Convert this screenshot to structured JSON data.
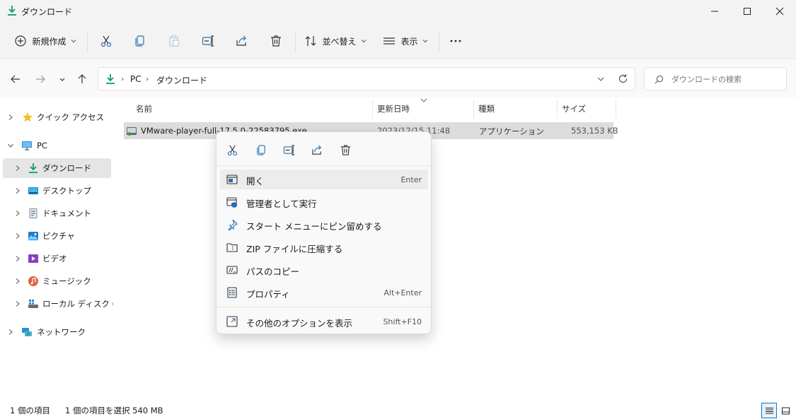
{
  "window": {
    "title": "ダウンロード",
    "accent": "#0f9a74"
  },
  "toolbar": {
    "new_label": "新規作成",
    "sort_label": "並べ替え",
    "view_label": "表示",
    "more_label": "..."
  },
  "address": {
    "crumbs": [
      "PC",
      "ダウンロード"
    ],
    "search_placeholder": "ダウンロードの検索"
  },
  "sidebar": {
    "items": [
      {
        "label": "クイック アクセス",
        "icon": "star-icon"
      },
      {
        "label": "PC",
        "icon": "pc-icon"
      },
      {
        "label": "ダウンロード",
        "icon": "download-icon"
      },
      {
        "label": "デスクトップ",
        "icon": "desktop-icon"
      },
      {
        "label": "ドキュメント",
        "icon": "document-icon"
      },
      {
        "label": "ピクチャ",
        "icon": "picture-icon"
      },
      {
        "label": "ビデオ",
        "icon": "video-icon"
      },
      {
        "label": "ミュージック",
        "icon": "music-icon"
      },
      {
        "label": "ローカル ディスク (C:)",
        "icon": "disk-icon"
      },
      {
        "label": "ネットワーク",
        "icon": "network-icon"
      }
    ]
  },
  "columns": {
    "name": "名前",
    "date": "更新日時",
    "type": "種類",
    "size": "サイズ"
  },
  "files": [
    {
      "name": "VMware-player-full-17.5.0-22583795.exe",
      "date": "2023/12/15 11:48",
      "type": "アプリケーション",
      "size": "553,153 KB"
    }
  ],
  "context_menu": {
    "items": [
      {
        "label": "開く",
        "shortcut": "Enter",
        "icon": "open-icon"
      },
      {
        "label": "管理者として実行",
        "shortcut": "",
        "icon": "admin-shield-icon"
      },
      {
        "label": "スタート メニューにピン留めする",
        "shortcut": "",
        "icon": "pin-icon"
      },
      {
        "label": "ZIP ファイルに圧縮する",
        "shortcut": "",
        "icon": "zip-icon"
      },
      {
        "label": "パスのコピー",
        "shortcut": "",
        "icon": "copy-path-icon"
      },
      {
        "label": "プロパティ",
        "shortcut": "Alt+Enter",
        "icon": "properties-icon"
      },
      {
        "label": "その他のオプションを表示",
        "shortcut": "Shift+F10",
        "icon": "more-options-icon"
      }
    ]
  },
  "status": {
    "item_count": "1 個の項目",
    "selection": "1 個の項目を選択  540 MB"
  }
}
